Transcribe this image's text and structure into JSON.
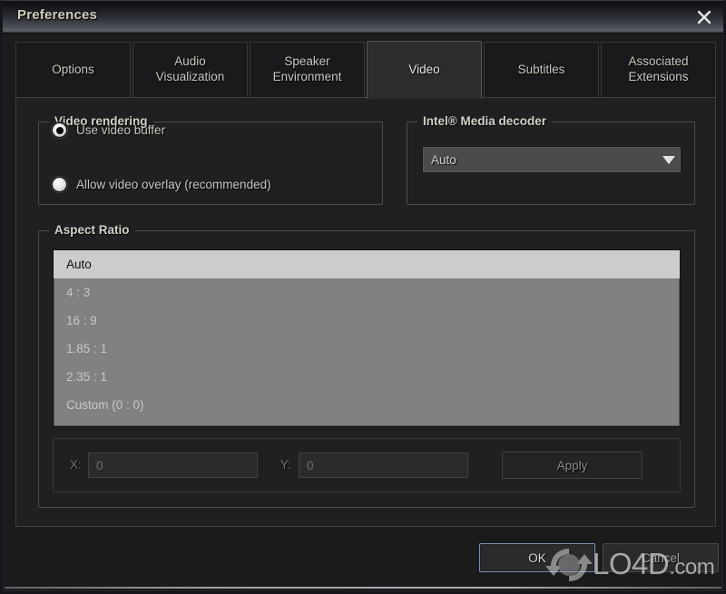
{
  "window": {
    "title": "Preferences",
    "close_icon": "close-icon"
  },
  "tabs": [
    {
      "label": "Options",
      "selected": false
    },
    {
      "label": "Audio\nVisualization",
      "selected": false
    },
    {
      "label": "Speaker\nEnvironment",
      "selected": false
    },
    {
      "label": "Video",
      "selected": true
    },
    {
      "label": "Subtitles",
      "selected": false
    },
    {
      "label": "Associated\nExtensions",
      "selected": false
    }
  ],
  "video_rendering": {
    "title": "Video rendering",
    "options": [
      {
        "label": "Allow video overlay (recommended)",
        "checked": false
      },
      {
        "label": "Use video buffer",
        "checked": true
      }
    ]
  },
  "intel_media_decoder": {
    "title": "Intel® Media decoder",
    "selected_value": "Auto",
    "arrow_icon": "chevron-down-icon"
  },
  "aspect_ratio": {
    "title": "Aspect Ratio",
    "items": [
      {
        "label": "Auto",
        "selected": true
      },
      {
        "label": "4 : 3",
        "selected": false
      },
      {
        "label": "16 : 9",
        "selected": false
      },
      {
        "label": "1.85 : 1",
        "selected": false
      },
      {
        "label": "2.35 : 1",
        "selected": false
      },
      {
        "label": "Custom (0 : 0)",
        "selected": false
      }
    ],
    "custom": {
      "x_label": "X:",
      "x_value": "0",
      "y_label": "Y:",
      "y_value": "0",
      "apply_label": "Apply"
    }
  },
  "footer": {
    "ok_label": "OK",
    "cancel_label": "Cancel"
  },
  "watermark": {
    "text": "LO4D",
    "suffix": ".com",
    "logo_icon": "refresh-circular-arrows-icon"
  },
  "colors": {
    "window_bg": "#1b1b1b",
    "content_bg": "#1f2022",
    "tab_bg": "#191a1c",
    "tab_selected_bg": "#2b2c2e",
    "text": "#cdc7bd",
    "list_bg": "#83817f",
    "list_selected_bg": "#cccccc",
    "focus_border": "#7d93bd"
  }
}
